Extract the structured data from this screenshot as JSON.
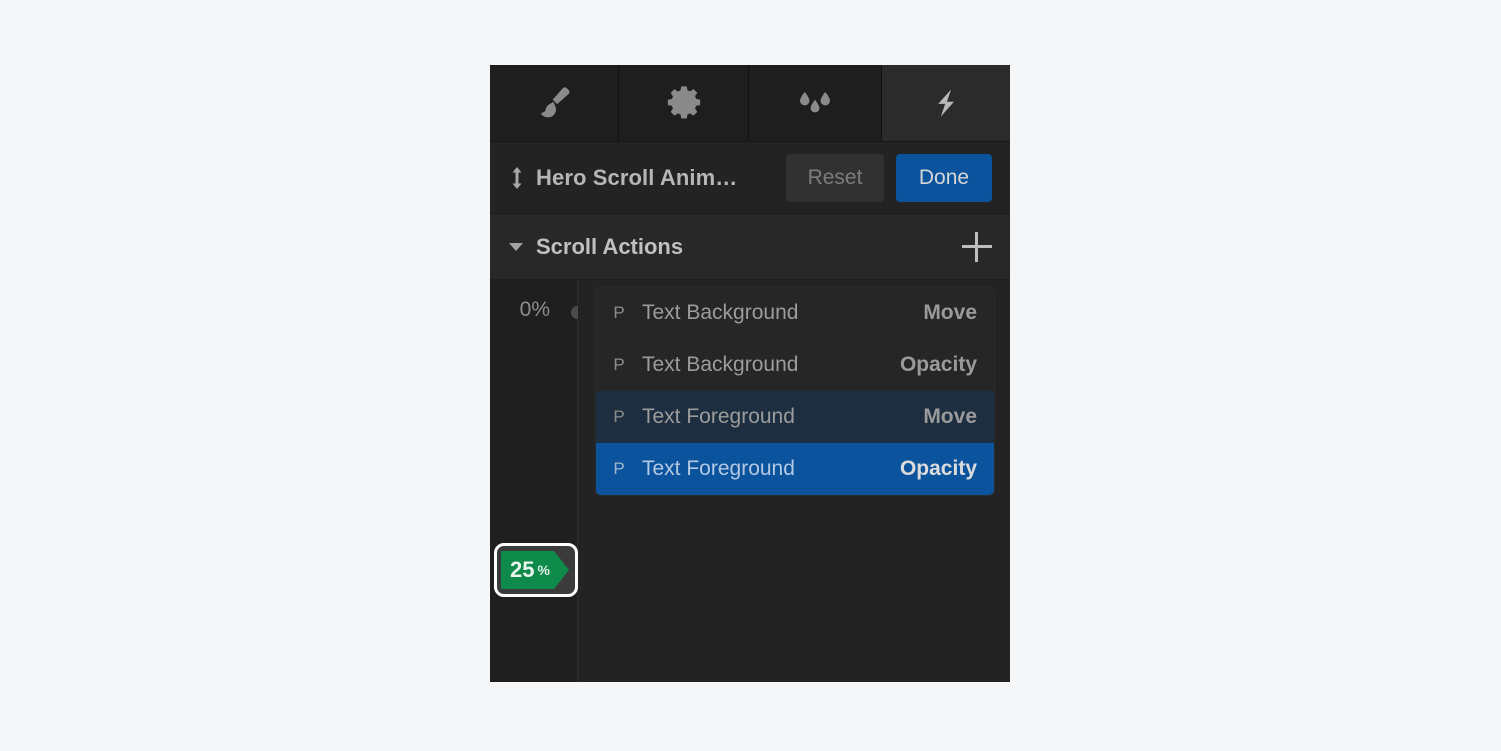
{
  "app": {
    "background_color": "#f5f6f8",
    "panel_background": "#232323",
    "accent_blue": "#0c539e",
    "accent_green": "#0e8a4a"
  },
  "tabs": [
    {
      "id": "style",
      "icon": "paint-brush-icon",
      "active": false
    },
    {
      "id": "settings",
      "icon": "gear-icon",
      "active": false
    },
    {
      "id": "effects",
      "icon": "water-drops-icon",
      "active": false
    },
    {
      "id": "animations",
      "icon": "lightning-bolt-icon",
      "active": true
    }
  ],
  "title_bar": {
    "resize_icon": "vertical-resize-arrow-icon",
    "animation_name": "Hero Scroll Anim…",
    "reset_label": "Reset",
    "done_label": "Done"
  },
  "section": {
    "caret_icon": "caret-down-icon",
    "title": "Scroll Actions",
    "add_icon": "plus-icon"
  },
  "timeline": {
    "start_label": "0%",
    "marker_icon": "keyframe-dot-icon",
    "playhead": {
      "value": "25",
      "unit": "%"
    }
  },
  "actions": [
    {
      "type_icon": "P",
      "label": "Text Background",
      "property": "Move",
      "state": "normal"
    },
    {
      "type_icon": "P",
      "label": "Text Background",
      "property": "Opacity",
      "state": "normal"
    },
    {
      "type_icon": "P",
      "label": "Text Foreground",
      "property": "Move",
      "state": "hover"
    },
    {
      "type_icon": "P",
      "label": "Text Foreground",
      "property": "Opacity",
      "state": "selected"
    }
  ]
}
